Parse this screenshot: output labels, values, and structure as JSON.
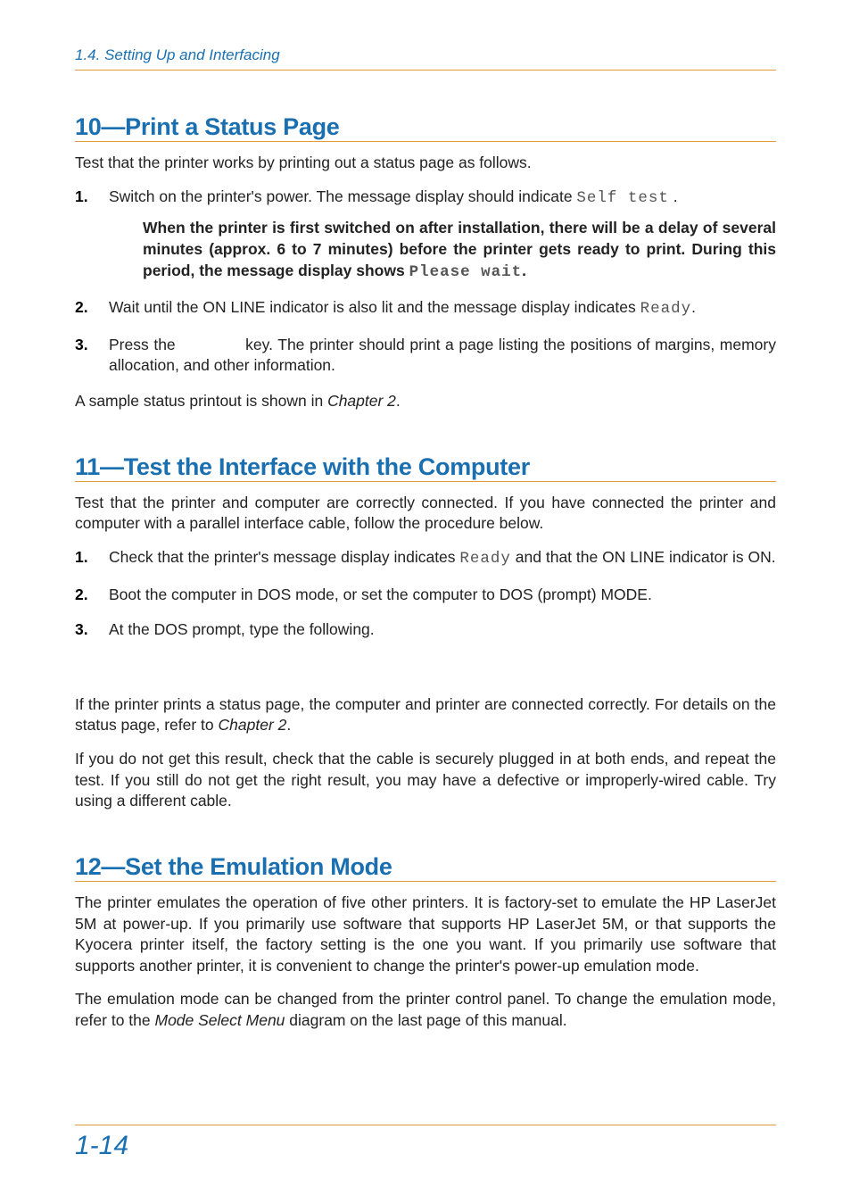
{
  "running_head": "1.4. Setting Up and Interfacing",
  "section10": {
    "title": "10—Print a Status Page",
    "intro": "Test that the printer works by printing out a status page as follows.",
    "step1_a": "Switch on the printer's power. The message display should indicate ",
    "step1_code": "Self test",
    "step1_b": " .",
    "warn_a": "When the printer is first switched on after installation, there will be a delay of several minutes (approx. 6 to 7 minutes) before the printer gets ready to print. During this period, the message display shows ",
    "warn_code": "Please wait",
    "warn_b": ".",
    "step2_a": "Wait until the ON LINE indicator is also lit and the message display indicates ",
    "step2_code": "Ready",
    "step2_b": ".",
    "step3_a": "Press the ",
    "step3_gap": "            ",
    "step3_b": " key. The printer should print a page listing the positions of margins, memory allocation, and other information.",
    "outro_a": "A sample status printout is shown in ",
    "outro_i": "Chapter 2",
    "outro_b": "."
  },
  "section11": {
    "title": "11—Test the Interface with the Computer",
    "intro": "Test that the printer and computer are correctly connected. If you have connected the printer and computer with a parallel interface cable, follow the procedure below.",
    "step1_a": "Check that the printer's message display indicates ",
    "step1_code": "Ready",
    "step1_b": " and that the ON LINE indicator is ON.",
    "step2": "Boot the computer in DOS mode, or set the computer to DOS (prompt) MODE.",
    "step3": "At the DOS prompt, type the following.",
    "para2_a": "If the printer prints a status page, the computer and printer are connected correctly. For details on the status page, refer to ",
    "para2_i": "Chapter 2",
    "para2_b": ".",
    "para3": "If you do not get this result, check that the cable is securely plugged in at both ends, and repeat the test. If you still do not get the right result, you may have a defective or improperly-wired cable. Try using a different cable."
  },
  "section12": {
    "title": "12—Set the Emulation Mode",
    "para1": "The printer emulates the operation of five other printers. It is factory-set to emulate the HP LaserJet 5M at power-up. If you primarily use software that supports HP LaserJet 5M, or that supports the Kyocera printer itself, the factory setting is the one you want. If you primarily use software that supports another printer, it is convenient to change the printer's power-up emulation mode.",
    "para2_a": "The emulation mode can be changed from the printer control panel. To change the emulation mode, refer to the ",
    "para2_i": "Mode Select Menu",
    "para2_b": " diagram on the last page of this manual."
  },
  "page_number": "1-14"
}
